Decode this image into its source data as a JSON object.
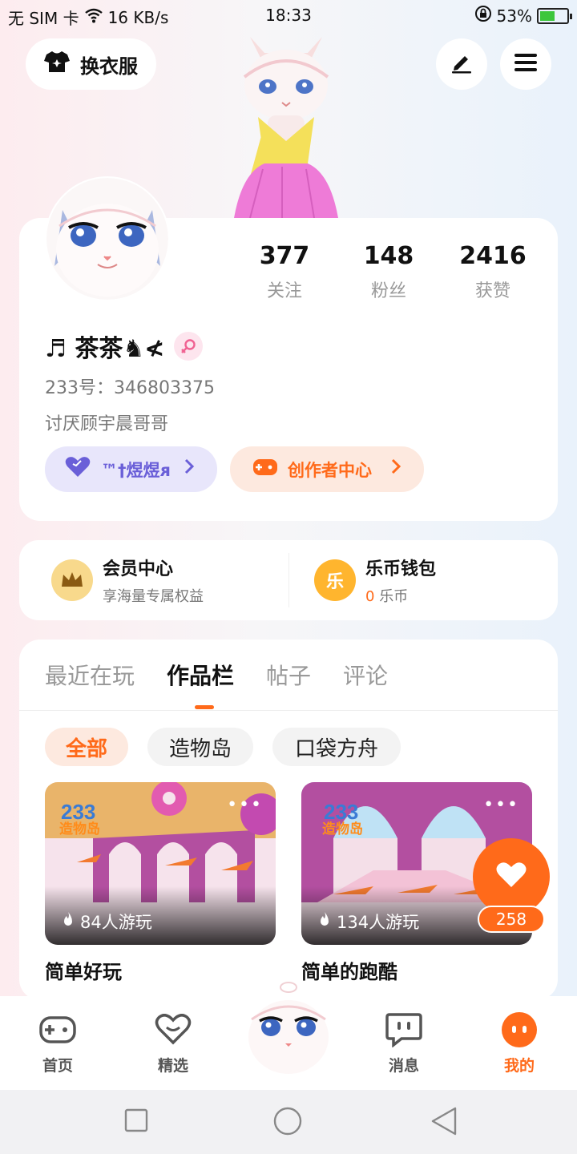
{
  "status": {
    "sim": "无 SIM 卡",
    "speed": "16 KB/s",
    "time": "18:33",
    "battery": "53%"
  },
  "header": {
    "outfit_label": "换衣服"
  },
  "profile": {
    "stats": [
      {
        "value": "377",
        "label": "关注"
      },
      {
        "value": "148",
        "label": "粉丝"
      },
      {
        "value": "2416",
        "label": "获赞"
      }
    ],
    "nickname": "♬ 茶茶♞≮",
    "uid": "233号：346803375",
    "bio": "讨厌顾宇晨哥哥",
    "badge_label": "™†煜煜ᴙ",
    "creator_label": "创作者中心"
  },
  "vip": {
    "member_title": "会员中心",
    "member_sub": "享海量专属权益",
    "wallet_title": "乐币钱包",
    "wallet_amount": "0",
    "wallet_unit": "乐币",
    "wallet_icon_char": "乐"
  },
  "tabs": [
    "最近在玩",
    "作品栏",
    "帖子",
    "评论"
  ],
  "chips": [
    "全部",
    "造物岛",
    "口袋方舟"
  ],
  "works": [
    {
      "plays": "84人游玩",
      "title": "简单好玩",
      "logo_top": "233",
      "logo_bottom": "造物岛"
    },
    {
      "plays": "134人游玩",
      "title": "简单的跑酷",
      "logo_top": "233",
      "logo_bottom": "造物岛"
    }
  ],
  "like_count": "258",
  "bottom_nav": [
    "首页",
    "精选",
    "消息",
    "我的"
  ],
  "colors": {
    "accent": "#ff6a1a",
    "purple": "#6a5fd8"
  }
}
